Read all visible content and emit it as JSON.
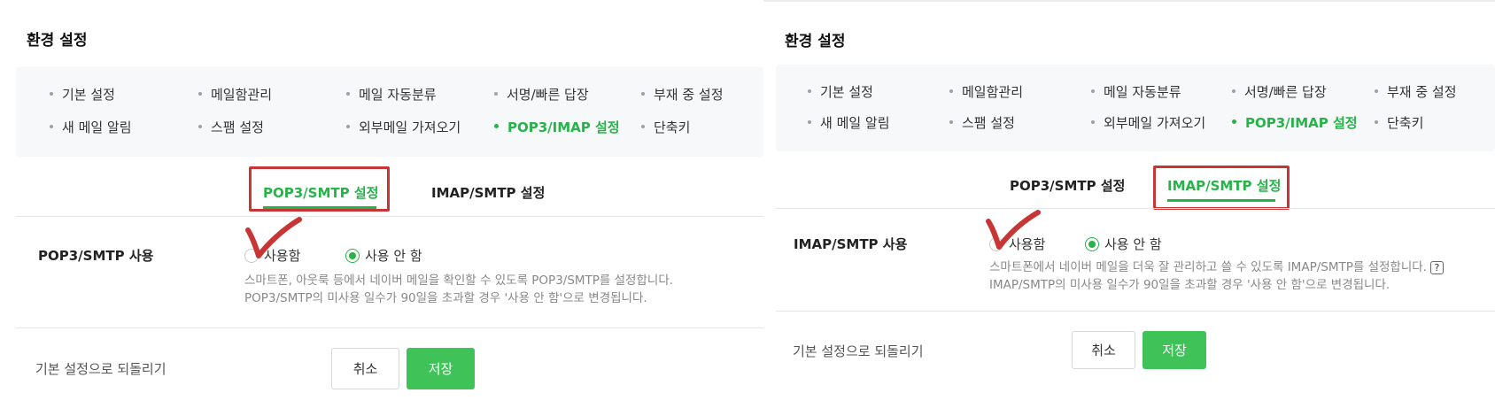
{
  "colors": {
    "accent": "#27b34a",
    "save_button": "#3fc359",
    "annotation": "#c73535"
  },
  "panels": [
    {
      "title": "환경 설정",
      "menu": [
        {
          "label": "기본 설정",
          "active": false
        },
        {
          "label": "메일함관리",
          "active": false
        },
        {
          "label": "메일 자동분류",
          "active": false
        },
        {
          "label": "서명/빠른 답장",
          "active": false
        },
        {
          "label": "부재 중 설정",
          "active": false
        },
        {
          "label": "새 메일 알림",
          "active": false
        },
        {
          "label": "스팸 설정",
          "active": false
        },
        {
          "label": "외부메일 가져오기",
          "active": false
        },
        {
          "label": "POP3/IMAP 설정",
          "active": true
        },
        {
          "label": "단축키",
          "active": false
        }
      ],
      "tabs": [
        {
          "label": "POP3/SMTP 설정",
          "active": true
        },
        {
          "label": "IMAP/SMTP 설정",
          "active": false
        }
      ],
      "setting_label": "POP3/SMTP 사용",
      "radio_on": "사용함",
      "radio_off": "사용 안 함",
      "selected": "사용 안 함",
      "desc_line1": "스마트폰, 아웃룩 등에서 네이버 메일을 확인할 수 있도록 POP3/SMTP를 설정합니다.",
      "desc_line2": "POP3/SMTP의 미사용 일수가 90일을 초과할 경우 '사용 안 함'으로 변경됩니다.",
      "reset_label": "기본 설정으로 되돌리기",
      "cancel_label": "취소",
      "save_label": "저장"
    },
    {
      "title": "환경 설정",
      "menu": [
        {
          "label": "기본 설정",
          "active": false
        },
        {
          "label": "메일함관리",
          "active": false
        },
        {
          "label": "메일 자동분류",
          "active": false
        },
        {
          "label": "서명/빠른 답장",
          "active": false
        },
        {
          "label": "부재 중 설정",
          "active": false
        },
        {
          "label": "새 메일 알림",
          "active": false
        },
        {
          "label": "스팸 설정",
          "active": false
        },
        {
          "label": "외부메일 가져오기",
          "active": false
        },
        {
          "label": "POP3/IMAP 설정",
          "active": true
        },
        {
          "label": "단축키",
          "active": false
        }
      ],
      "tabs": [
        {
          "label": "POP3/SMTP 설정",
          "active": false
        },
        {
          "label": "IMAP/SMTP 설정",
          "active": true
        }
      ],
      "setting_label": "IMAP/SMTP 사용",
      "radio_on": "사용함",
      "radio_off": "사용 안 함",
      "selected": "사용 안 함",
      "desc_line1": "스마트폰에서 네이버 메일을 더욱 잘 관리하고 쓸 수 있도록 IMAP/SMTP를 설정합니다.",
      "help_icon": "?",
      "desc_line2": "IMAP/SMTP의 미사용 일수가 90일을 초과할 경우 '사용 안 함'으로 변경됩니다.",
      "reset_label": "기본 설정으로 되돌리기",
      "cancel_label": "취소",
      "save_label": "저장"
    }
  ]
}
